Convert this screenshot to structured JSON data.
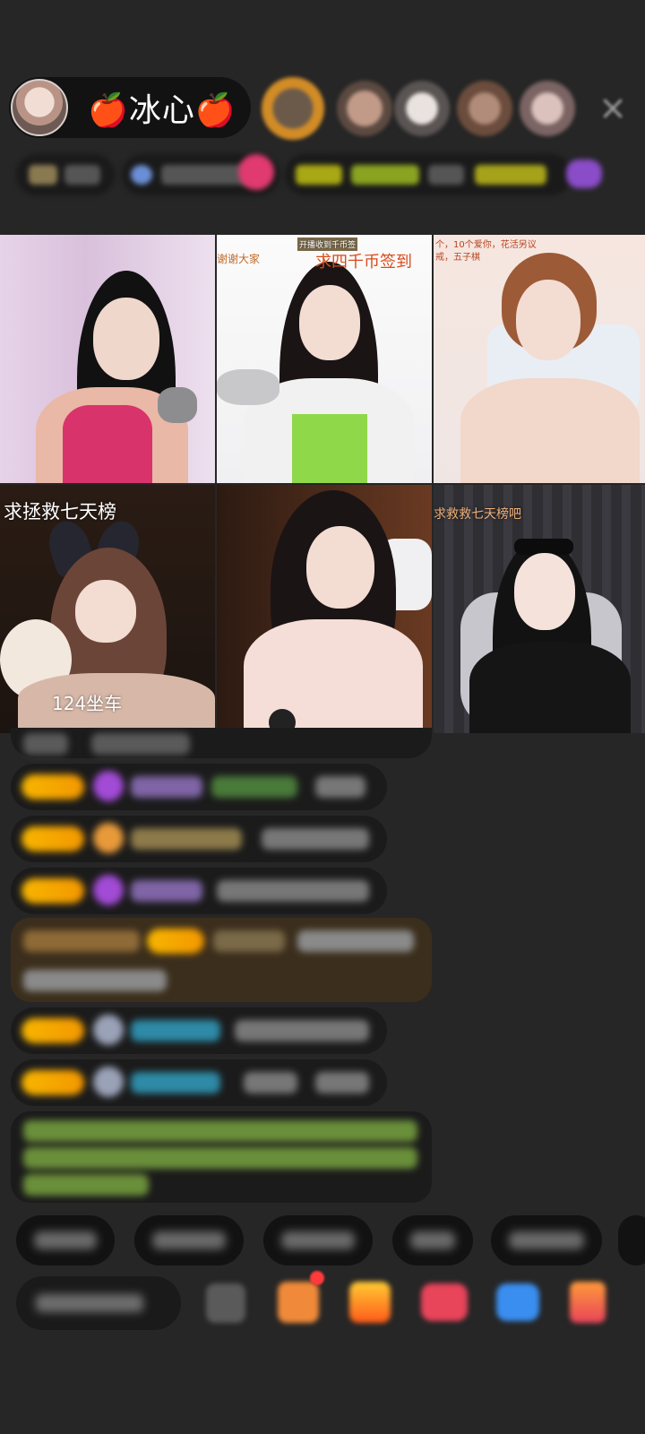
{
  "host": {
    "name": "🍎冰心🍎"
  },
  "viewers": [
    {
      "icon": "viewer-avatar-1"
    },
    {
      "icon": "viewer-avatar-2"
    },
    {
      "icon": "viewer-avatar-3"
    },
    {
      "icon": "viewer-avatar-4"
    },
    {
      "icon": "viewer-avatar-5"
    }
  ],
  "close_icon": "×",
  "tiles": [
    {
      "overlay_lines": []
    },
    {
      "overlay_lines": [
        "求四千币签到",
        "开播收到千币签",
        "谢谢大家"
      ]
    },
    {
      "overlay_lines": [
        "个，10个爱你，花活另议",
        "戒，五子棋"
      ]
    },
    {
      "overlay_lines": [
        "求拯救七天榜",
        "124坐车"
      ]
    },
    {
      "overlay_lines": []
    },
    {
      "overlay_lines": [
        "求救救七天榜吧"
      ]
    }
  ],
  "colors": {
    "background": "#262626",
    "badge_gold": "#f7b500",
    "gift_purple": "#a24bd6",
    "chat_green": "#7ab52b",
    "chat_cyan": "#2ea8c8"
  }
}
